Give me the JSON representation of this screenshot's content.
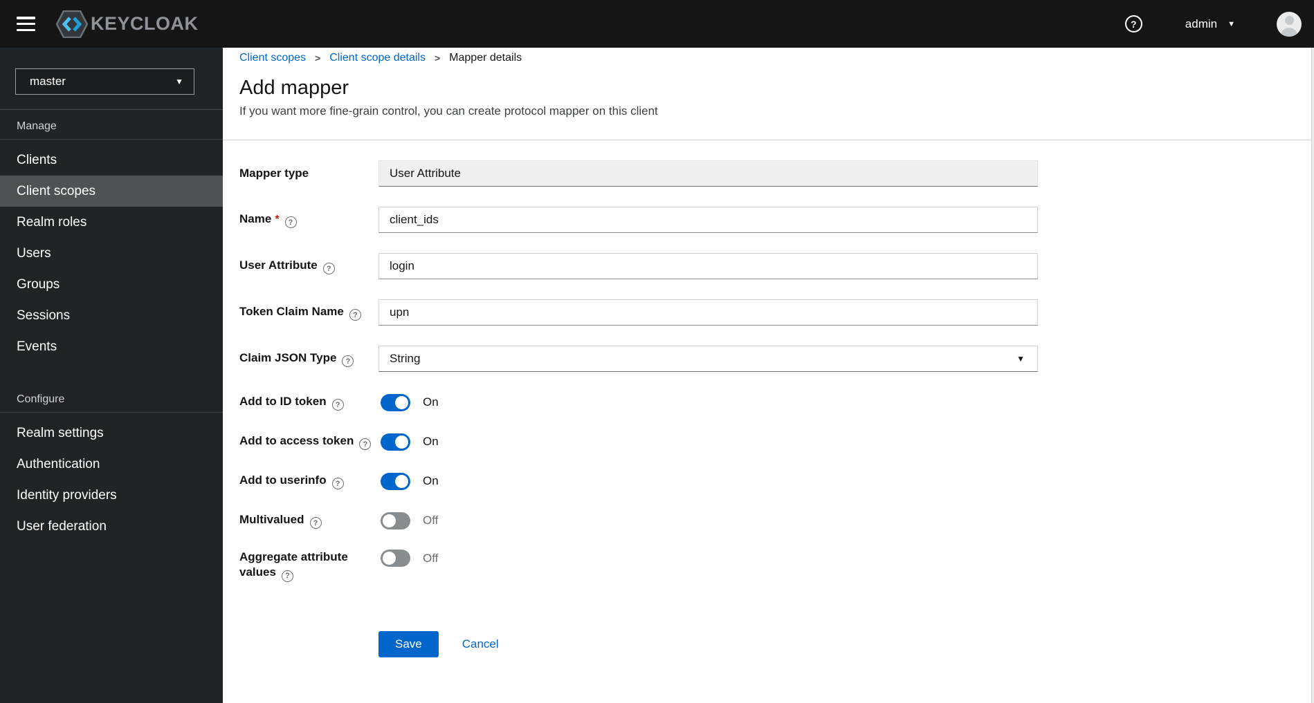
{
  "topbar": {
    "brand_text": "KEYCLOAK",
    "user_label": "admin"
  },
  "icons": {
    "help_glyph": "?",
    "caret_down": "▼",
    "breadcrumb_separator": ">"
  },
  "sidebar": {
    "realm_selector": {
      "value": "master"
    },
    "sections": [
      {
        "title": "Manage",
        "items": [
          {
            "label": "Clients"
          },
          {
            "label": "Client scopes",
            "selected": true
          },
          {
            "label": "Realm roles"
          },
          {
            "label": "Users"
          },
          {
            "label": "Groups"
          },
          {
            "label": "Sessions"
          },
          {
            "label": "Events"
          }
        ]
      },
      {
        "title": "Configure",
        "items": [
          {
            "label": "Realm settings"
          },
          {
            "label": "Authentication"
          },
          {
            "label": "Identity providers"
          },
          {
            "label": "User federation"
          }
        ]
      }
    ]
  },
  "breadcrumb": {
    "items": [
      {
        "label": "Client scopes"
      },
      {
        "label": "Client scope details"
      },
      {
        "label": "Mapper details"
      }
    ]
  },
  "page": {
    "title": "Add mapper",
    "subtitle": "If you want more fine-grain control, you can create protocol mapper on this client"
  },
  "form": {
    "fields": [
      {
        "label": "Mapper type",
        "type": "readonly",
        "value": "User Attribute"
      },
      {
        "label": "Name",
        "required_marker": "*",
        "type": "text",
        "value": "client_ids"
      },
      {
        "label": "User Attribute",
        "type": "text",
        "value": "login"
      },
      {
        "label": "Token Claim Name",
        "type": "text",
        "value": "upn"
      },
      {
        "label": "Claim JSON Type",
        "type": "select",
        "value": "String"
      },
      {
        "label": "Add to ID token",
        "type": "switch",
        "state": "on",
        "state_label": "On"
      },
      {
        "label": "Add to access token",
        "type": "switch",
        "state": "on",
        "state_label": "On"
      },
      {
        "label": "Add to userinfo",
        "type": "switch",
        "state": "on",
        "state_label": "On"
      },
      {
        "label": "Multivalued",
        "type": "switch",
        "state": "off",
        "state_label": "Off"
      },
      {
        "label": "Aggregate attribute values",
        "type": "switch",
        "state": "off",
        "state_label": "Off"
      }
    ],
    "actions": {
      "save_label": "Save",
      "cancel_label": "Cancel"
    }
  },
  "colors": {
    "primary": "#0066cc",
    "topbar_bg": "#151515",
    "sidebar_bg": "#212427",
    "sidebar_selected_bg": "#4f5255",
    "switch_off": "#8a8d90",
    "link": "#0066cc",
    "required_marker": "#c9190b"
  }
}
